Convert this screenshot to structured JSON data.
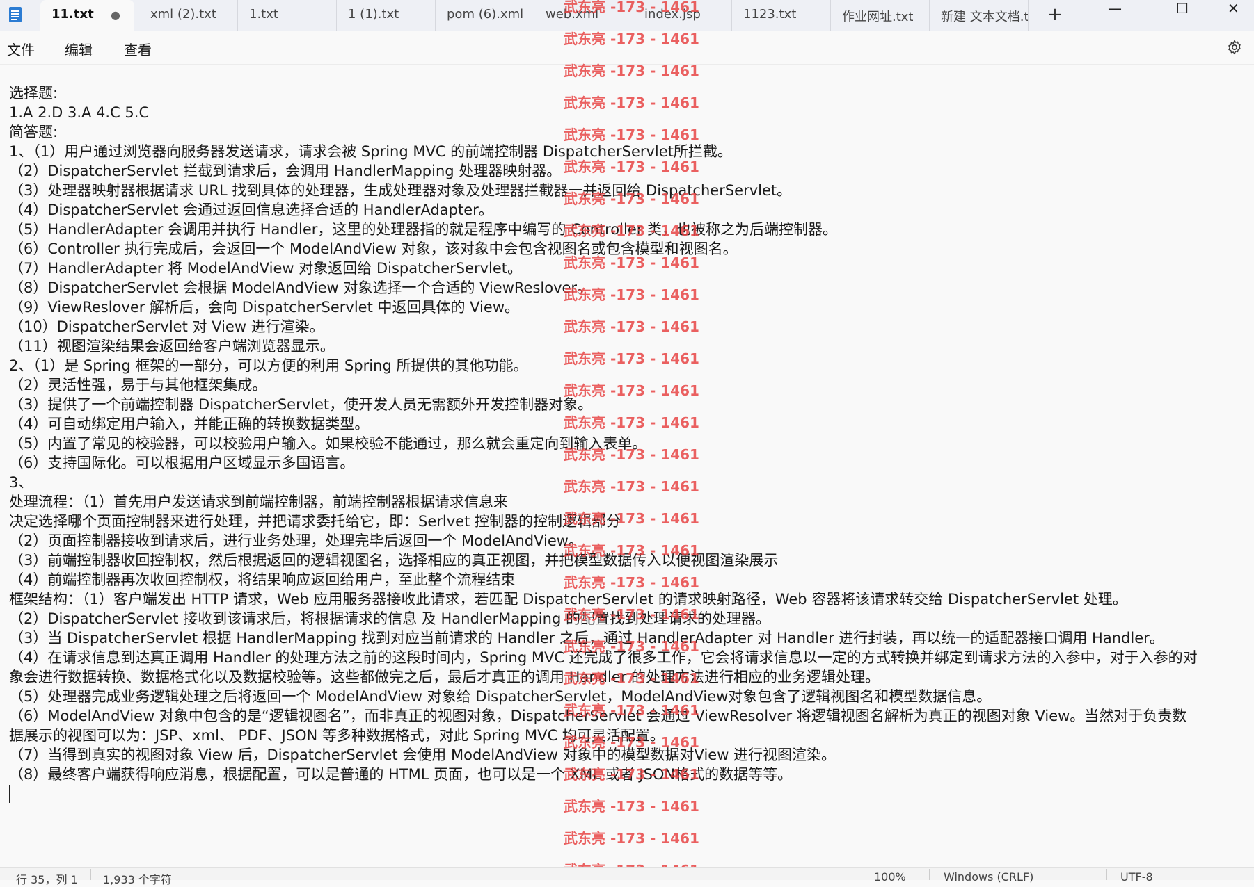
{
  "tabs": [
    {
      "label": "11.txt",
      "active": true,
      "modified": true
    },
    {
      "label": "xml (2).txt"
    },
    {
      "label": "1.txt"
    },
    {
      "label": "1 (1).txt"
    },
    {
      "label": "pom (6).xml"
    },
    {
      "label": "web.xml"
    },
    {
      "label": "index.jsp"
    },
    {
      "label": "1123.txt"
    },
    {
      "label": "作业网址.txt"
    },
    {
      "label": "新建 文本文档.t"
    }
  ],
  "tab_add": "+",
  "window_controls": {
    "minimize": "—",
    "maximize": "☐",
    "close": "✕"
  },
  "menu": [
    "文件",
    "编辑",
    "查看"
  ],
  "lines": [
    "选择题:",
    "1.A 2.D 3.A 4.C 5.C",
    "简答题:",
    "1、（1）用户通过浏览器向服务器发送请求，请求会被 Spring MVC 的前端控制器 DispatcherServlet所拦截。",
    "（2）DispatcherServlet 拦截到请求后，会调用 HandlerMapping 处理器映射器。",
    "（3）处理器映射器根据请求 URL 找到具体的处理器，生成处理器对象及处理器拦截器一并返回给 DispatcherServlet。",
    "（4）DispatcherServlet 会通过返回信息选择合适的 HandlerAdapter。",
    "（5）HandlerAdapter 会调用并执行 Handler，这里的处理器指的就是程序中编写的 Controller 类，也被称之为后端控制器。",
    "（6）Controller 执行完成后，会返回一个 ModelAndView 对象，该对象中会包含视图名或包含模型和视图名。",
    "（7）HandlerAdapter 将 ModelAndView 对象返回给 DispatcherServlet。",
    "（8）DispatcherServlet 会根据 ModelAndView 对象选择一个合适的 ViewReslover。",
    "（9）ViewReslover 解析后，会向 DispatcherServlet 中返回具体的 View。",
    "（10）DispatcherServlet 对 View 进行渲染。",
    "（11）视图渲染结果会返回给客户端浏览器显示。",
    "2、（1）是 Spring 框架的一部分，可以方便的利用 Spring 所提供的其他功能。",
    "（2）灵活性强，易于与其他框架集成。",
    "（3）提供了一个前端控制器 DispatcherServlet，使开发人员无需额外开发控制器对象。",
    "（4）可自动绑定用户输入，并能正确的转换数据类型。",
    "（5）内置了常见的校验器，可以校验用户输入。如果校验不能通过，那么就会重定向到输入表单。",
    "（6）支持国际化。可以根据用户区域显示多国语言。",
    "3、",
    "处理流程：（1）首先用户发送请求到前端控制器，前端控制器根据请求信息来",
    "决定选择哪个页面控制器来进行处理，并把请求委托给它，即：Serlvet 控制器的控制逻辑部分",
    "（2）页面控制器接收到请求后，进行业务处理，处理完毕后返回一个 ModelAndView。",
    "（3）前端控制器收回控制权，然后根据返回的逻辑视图名，选择相应的真正视图，并把模型数据传入以便视图渲染展示",
    "（4）前端控制器再次收回控制权，将结果响应返回给用户，至此整个流程结束",
    "框架结构：（1）客户端发出 HTTP 请求，Web 应用服务器接收此请求，若匹配 DispatcherServlet 的请求映射路径，Web 容器将该请求转交给 DispatcherServlet 处理。",
    "（2）DispatcherServlet 接收到该请求后，将根据请求的信息 及 HandlerMapping 的配置找到处理请求的处理器。",
    "（3）当 DispatcherServlet 根据 HandlerMapping 找到对应当前请求的 Handler 之后，通过 HandlerAdapter 对 Handler 进行封装，再以统一的适配器接口调用 Handler。",
    "（4）在请求信息到达真正调用 Handler 的处理方法之前的这段时间内，Spring MVC 还完成了很多工作，它会将请求信息以一定的方式转换并绑定到请求方法的入参中，对于入参的对",
    "象会进行数据转换、数据格式化以及数据校验等。这些都做完之后，最后才真正的调用 Handler 的处理方法进行相应的业务逻辑处理。",
    "（5）处理器完成业务逻辑处理之后将返回一个 ModelAndView 对象给 DispatcherServlet，ModelAndView对象包含了逻辑视图名和模型数据信息。",
    "（6）ModelAndView 对象中包含的是“逻辑视图名”，而非真正的视图对象，DispatcherServlet 会通过 ViewResolver 将逻辑视图名解析为真正的视图对象 View。当然对于负责数",
    "据展示的视图可以为：JSP、xml、 PDF、JSON 等多种数据格式，对此 Spring MVC 均可灵活配置。",
    "（7）当得到真实的视图对象 View 后，DispatcherServlet 会使用 ModelAndView 对象中的模型数据对View 进行视图渲染。",
    "（8）最终客户端获得响应消息，根据配置，可以是普通的 HTML 页面，也可以是一个 XML 或者 JSON格式的数据等等。"
  ],
  "watermark": {
    "text": "武东亮 -173 - 1461",
    "color": "#e84646"
  },
  "status": {
    "position": "行 35，列 1",
    "chars": "1,933 个字符",
    "zoom": "100%",
    "line_ending": "Windows (CRLF)",
    "encoding": "UTF-8"
  }
}
